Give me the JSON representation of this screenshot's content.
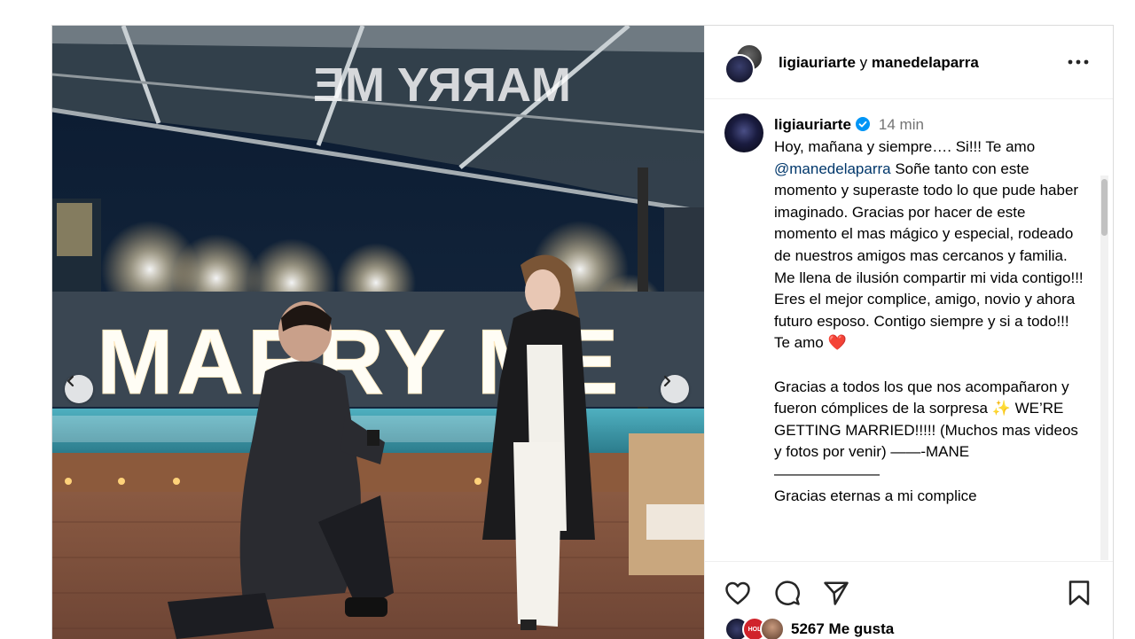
{
  "header": {
    "user1": "ligiauriarte",
    "connector": "y",
    "user2": "manedelaparra"
  },
  "photo": {
    "sign_text": "MARRY ME"
  },
  "caption": {
    "username": "ligiauriarte",
    "time": "14 min",
    "line1": "Hoy, mañana y siempre…. Si!!! Te amo",
    "mention": "@manedelaparra",
    "body1": " Soñe tanto con este momento y superaste todo lo que pude haber imaginado. Gracias por hacer de este momento el mas mágico y especial, rodeado de nuestros amigos mas cercanos y familia. Me llena de ilusión compartir mi vida contigo!!! Eres el mejor complice, amigo, novio y ahora futuro esposo. Contigo siempre y si a todo!!! Te amo ❤️",
    "body2": "Gracias a todos los que nos acompañaron y fueron cómplices de la sorpresa ✨ WE’RE GETTING MARRIED!!!!! (Muchos mas videos y fotos por venir) ——-MANE",
    "divider": "———————",
    "body3": "Gracias eternas a mi complice"
  },
  "likes": {
    "text": "5267 Me gusta",
    "avatar_badge": "HOL"
  },
  "icons": [
    "more-icon",
    "verified-icon",
    "heart-icon",
    "comment-icon",
    "share-icon",
    "bookmark-icon",
    "chevron-left-icon",
    "chevron-right-icon"
  ],
  "colors": {
    "verified": "#0095f6",
    "mention": "#00376b",
    "secondary": "#737373"
  }
}
